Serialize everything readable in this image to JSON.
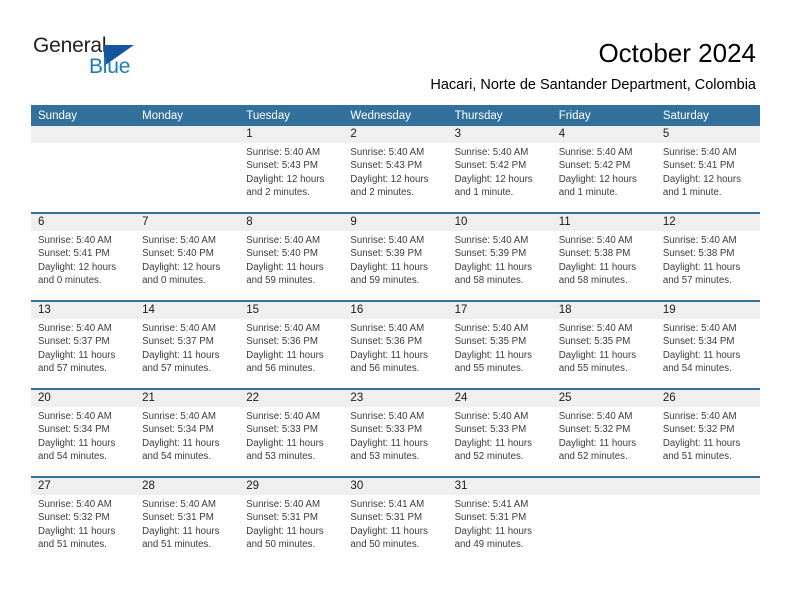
{
  "brand": {
    "name_part1": "General",
    "name_part2": "Blue",
    "triangle_color": "#13569e",
    "blue_color": "#1f7bc1"
  },
  "header": {
    "title": "October 2024",
    "subtitle": "Hacari, Norte de Santander Department, Colombia"
  },
  "theme": {
    "header_bg": "#31719b",
    "header_text": "#ffffff",
    "daynum_band_bg": "#efefef",
    "cell_bg": "#ffffff",
    "week_divider": "#31719b"
  },
  "weekday_headers": [
    "Sunday",
    "Monday",
    "Tuesday",
    "Wednesday",
    "Thursday",
    "Friday",
    "Saturday"
  ],
  "weeks": [
    [
      {
        "day": "",
        "empty": true,
        "sunrise": "",
        "sunset": "",
        "daylight_l1": "",
        "daylight_l2": ""
      },
      {
        "day": "",
        "empty": true,
        "sunrise": "",
        "sunset": "",
        "daylight_l1": "",
        "daylight_l2": ""
      },
      {
        "day": "1",
        "sunrise": "Sunrise: 5:40 AM",
        "sunset": "Sunset: 5:43 PM",
        "daylight_l1": "Daylight: 12 hours",
        "daylight_l2": "and 2 minutes."
      },
      {
        "day": "2",
        "sunrise": "Sunrise: 5:40 AM",
        "sunset": "Sunset: 5:43 PM",
        "daylight_l1": "Daylight: 12 hours",
        "daylight_l2": "and 2 minutes."
      },
      {
        "day": "3",
        "sunrise": "Sunrise: 5:40 AM",
        "sunset": "Sunset: 5:42 PM",
        "daylight_l1": "Daylight: 12 hours",
        "daylight_l2": "and 1 minute."
      },
      {
        "day": "4",
        "sunrise": "Sunrise: 5:40 AM",
        "sunset": "Sunset: 5:42 PM",
        "daylight_l1": "Daylight: 12 hours",
        "daylight_l2": "and 1 minute."
      },
      {
        "day": "5",
        "sunrise": "Sunrise: 5:40 AM",
        "sunset": "Sunset: 5:41 PM",
        "daylight_l1": "Daylight: 12 hours",
        "daylight_l2": "and 1 minute."
      }
    ],
    [
      {
        "day": "6",
        "sunrise": "Sunrise: 5:40 AM",
        "sunset": "Sunset: 5:41 PM",
        "daylight_l1": "Daylight: 12 hours",
        "daylight_l2": "and 0 minutes."
      },
      {
        "day": "7",
        "sunrise": "Sunrise: 5:40 AM",
        "sunset": "Sunset: 5:40 PM",
        "daylight_l1": "Daylight: 12 hours",
        "daylight_l2": "and 0 minutes."
      },
      {
        "day": "8",
        "sunrise": "Sunrise: 5:40 AM",
        "sunset": "Sunset: 5:40 PM",
        "daylight_l1": "Daylight: 11 hours",
        "daylight_l2": "and 59 minutes."
      },
      {
        "day": "9",
        "sunrise": "Sunrise: 5:40 AM",
        "sunset": "Sunset: 5:39 PM",
        "daylight_l1": "Daylight: 11 hours",
        "daylight_l2": "and 59 minutes."
      },
      {
        "day": "10",
        "sunrise": "Sunrise: 5:40 AM",
        "sunset": "Sunset: 5:39 PM",
        "daylight_l1": "Daylight: 11 hours",
        "daylight_l2": "and 58 minutes."
      },
      {
        "day": "11",
        "sunrise": "Sunrise: 5:40 AM",
        "sunset": "Sunset: 5:38 PM",
        "daylight_l1": "Daylight: 11 hours",
        "daylight_l2": "and 58 minutes."
      },
      {
        "day": "12",
        "sunrise": "Sunrise: 5:40 AM",
        "sunset": "Sunset: 5:38 PM",
        "daylight_l1": "Daylight: 11 hours",
        "daylight_l2": "and 57 minutes."
      }
    ],
    [
      {
        "day": "13",
        "sunrise": "Sunrise: 5:40 AM",
        "sunset": "Sunset: 5:37 PM",
        "daylight_l1": "Daylight: 11 hours",
        "daylight_l2": "and 57 minutes."
      },
      {
        "day": "14",
        "sunrise": "Sunrise: 5:40 AM",
        "sunset": "Sunset: 5:37 PM",
        "daylight_l1": "Daylight: 11 hours",
        "daylight_l2": "and 57 minutes."
      },
      {
        "day": "15",
        "sunrise": "Sunrise: 5:40 AM",
        "sunset": "Sunset: 5:36 PM",
        "daylight_l1": "Daylight: 11 hours",
        "daylight_l2": "and 56 minutes."
      },
      {
        "day": "16",
        "sunrise": "Sunrise: 5:40 AM",
        "sunset": "Sunset: 5:36 PM",
        "daylight_l1": "Daylight: 11 hours",
        "daylight_l2": "and 56 minutes."
      },
      {
        "day": "17",
        "sunrise": "Sunrise: 5:40 AM",
        "sunset": "Sunset: 5:35 PM",
        "daylight_l1": "Daylight: 11 hours",
        "daylight_l2": "and 55 minutes."
      },
      {
        "day": "18",
        "sunrise": "Sunrise: 5:40 AM",
        "sunset": "Sunset: 5:35 PM",
        "daylight_l1": "Daylight: 11 hours",
        "daylight_l2": "and 55 minutes."
      },
      {
        "day": "19",
        "sunrise": "Sunrise: 5:40 AM",
        "sunset": "Sunset: 5:34 PM",
        "daylight_l1": "Daylight: 11 hours",
        "daylight_l2": "and 54 minutes."
      }
    ],
    [
      {
        "day": "20",
        "sunrise": "Sunrise: 5:40 AM",
        "sunset": "Sunset: 5:34 PM",
        "daylight_l1": "Daylight: 11 hours",
        "daylight_l2": "and 54 minutes."
      },
      {
        "day": "21",
        "sunrise": "Sunrise: 5:40 AM",
        "sunset": "Sunset: 5:34 PM",
        "daylight_l1": "Daylight: 11 hours",
        "daylight_l2": "and 54 minutes."
      },
      {
        "day": "22",
        "sunrise": "Sunrise: 5:40 AM",
        "sunset": "Sunset: 5:33 PM",
        "daylight_l1": "Daylight: 11 hours",
        "daylight_l2": "and 53 minutes."
      },
      {
        "day": "23",
        "sunrise": "Sunrise: 5:40 AM",
        "sunset": "Sunset: 5:33 PM",
        "daylight_l1": "Daylight: 11 hours",
        "daylight_l2": "and 53 minutes."
      },
      {
        "day": "24",
        "sunrise": "Sunrise: 5:40 AM",
        "sunset": "Sunset: 5:33 PM",
        "daylight_l1": "Daylight: 11 hours",
        "daylight_l2": "and 52 minutes."
      },
      {
        "day": "25",
        "sunrise": "Sunrise: 5:40 AM",
        "sunset": "Sunset: 5:32 PM",
        "daylight_l1": "Daylight: 11 hours",
        "daylight_l2": "and 52 minutes."
      },
      {
        "day": "26",
        "sunrise": "Sunrise: 5:40 AM",
        "sunset": "Sunset: 5:32 PM",
        "daylight_l1": "Daylight: 11 hours",
        "daylight_l2": "and 51 minutes."
      }
    ],
    [
      {
        "day": "27",
        "sunrise": "Sunrise: 5:40 AM",
        "sunset": "Sunset: 5:32 PM",
        "daylight_l1": "Daylight: 11 hours",
        "daylight_l2": "and 51 minutes."
      },
      {
        "day": "28",
        "sunrise": "Sunrise: 5:40 AM",
        "sunset": "Sunset: 5:31 PM",
        "daylight_l1": "Daylight: 11 hours",
        "daylight_l2": "and 51 minutes."
      },
      {
        "day": "29",
        "sunrise": "Sunrise: 5:40 AM",
        "sunset": "Sunset: 5:31 PM",
        "daylight_l1": "Daylight: 11 hours",
        "daylight_l2": "and 50 minutes."
      },
      {
        "day": "30",
        "sunrise": "Sunrise: 5:41 AM",
        "sunset": "Sunset: 5:31 PM",
        "daylight_l1": "Daylight: 11 hours",
        "daylight_l2": "and 50 minutes."
      },
      {
        "day": "31",
        "sunrise": "Sunrise: 5:41 AM",
        "sunset": "Sunset: 5:31 PM",
        "daylight_l1": "Daylight: 11 hours",
        "daylight_l2": "and 49 minutes."
      },
      {
        "day": "",
        "empty": true,
        "sunrise": "",
        "sunset": "",
        "daylight_l1": "",
        "daylight_l2": ""
      },
      {
        "day": "",
        "empty": true,
        "sunrise": "",
        "sunset": "",
        "daylight_l1": "",
        "daylight_l2": ""
      }
    ]
  ]
}
